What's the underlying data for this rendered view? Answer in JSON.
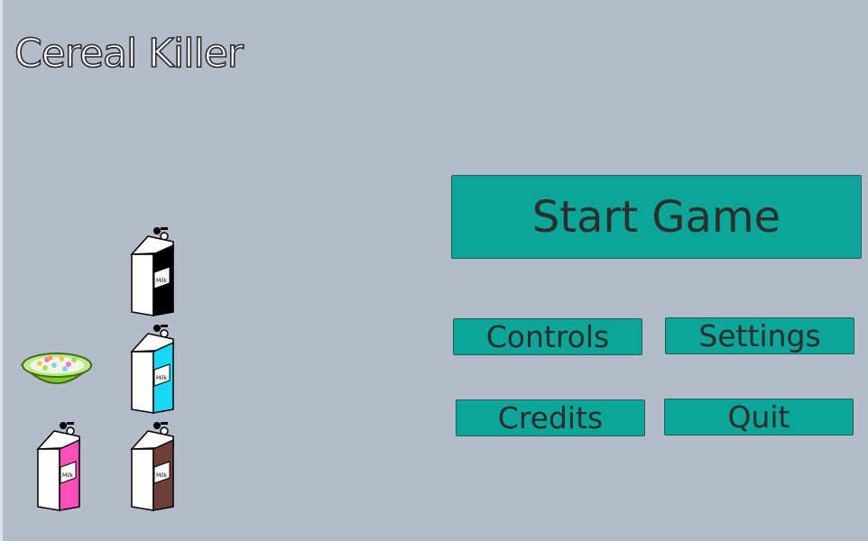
{
  "game": {
    "title": "Cereal Killer"
  },
  "menu": {
    "start_label": "Start Game",
    "controls_label": "Controls",
    "settings_label": "Settings",
    "credits_label": "Credits",
    "quit_label": "Quit"
  },
  "sprites": {
    "carton_label": "Milk",
    "cartons": [
      {
        "name": "black-milk-carton",
        "color": "#000000"
      },
      {
        "name": "blue-milk-carton",
        "color": "#19d6f2"
      },
      {
        "name": "pink-milk-carton",
        "color": "#ff4fb8"
      },
      {
        "name": "brown-milk-carton",
        "color": "#6e3f36"
      }
    ],
    "bowl": {
      "name": "cereal-bowl",
      "color": "#7ecb2c"
    }
  },
  "colors": {
    "background": "#b5bcc9",
    "button": "#0ca597",
    "button_text": "#2d2d2d"
  }
}
